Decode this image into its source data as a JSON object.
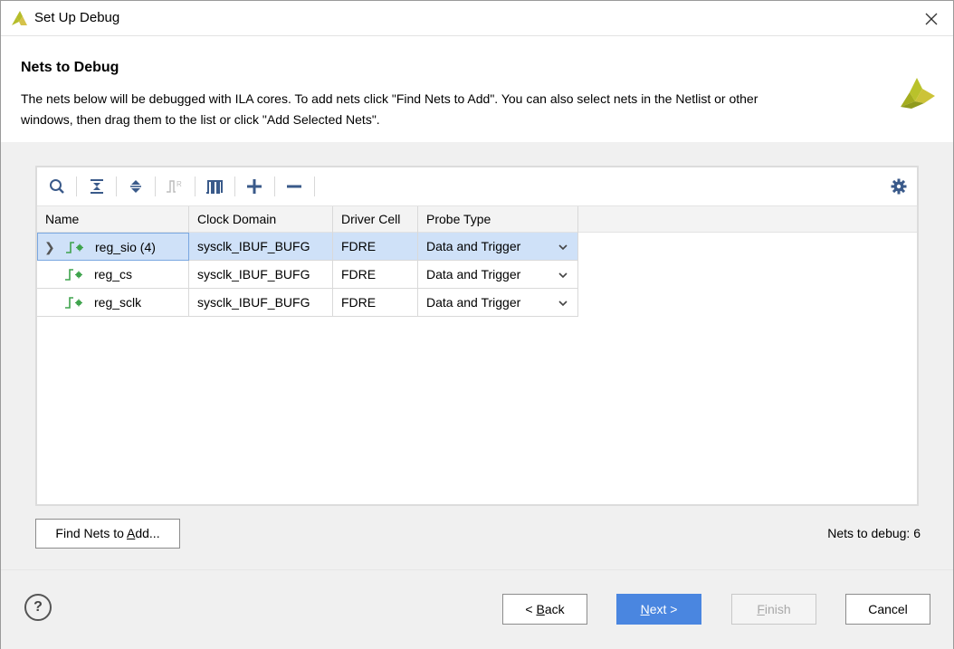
{
  "window": {
    "title": "Set Up Debug",
    "close_icon": "close-icon"
  },
  "header": {
    "title": "Nets to Debug",
    "description_line1": "The nets below will be debugged with ILA cores. To add nets click \"Find Nets to Add\". You can also select nets in the Netlist or other",
    "description_line2": "windows, then drag them to the list or click \"Add Selected Nets\"."
  },
  "toolbar": {
    "icons": [
      "search-icon",
      "collapse-all-icon",
      "expand-all-icon",
      "waveform-icon",
      "bus-icon",
      "add-icon",
      "remove-icon",
      "gear-icon"
    ]
  },
  "table": {
    "columns": [
      "Name",
      "Clock Domain",
      "Driver Cell",
      "Probe Type"
    ],
    "rows": [
      {
        "name": "reg_sio (4)",
        "clock": "sysclk_IBUF_BUFG",
        "driver": "FDRE",
        "probe": "Data and Trigger",
        "expandable": true,
        "selected": true
      },
      {
        "name": "reg_cs",
        "clock": "sysclk_IBUF_BUFG",
        "driver": "FDRE",
        "probe": "Data and Trigger",
        "expandable": false,
        "selected": false
      },
      {
        "name": "reg_sclk",
        "clock": "sysclk_IBUF_BUFG",
        "driver": "FDRE",
        "probe": "Data and Trigger",
        "expandable": false,
        "selected": false
      }
    ]
  },
  "actions": {
    "find_nets_prefix": "Find Nets to ",
    "find_nets_underline": "A",
    "find_nets_suffix": "dd...",
    "count_label": "Nets to debug: 6"
  },
  "footer": {
    "help_label": "?",
    "back_prefix": "< ",
    "back_underline": "B",
    "back_suffix": "ack",
    "next_underline": "N",
    "next_suffix": "ext >",
    "finish_underline": "F",
    "finish_suffix": "inish",
    "cancel_label": "Cancel"
  },
  "colors": {
    "accent": "#4a86e0",
    "selected_row": "#cfe1f8",
    "brand_yellow": "#b5bd2a",
    "net_icon_green": "#3fa34d"
  }
}
